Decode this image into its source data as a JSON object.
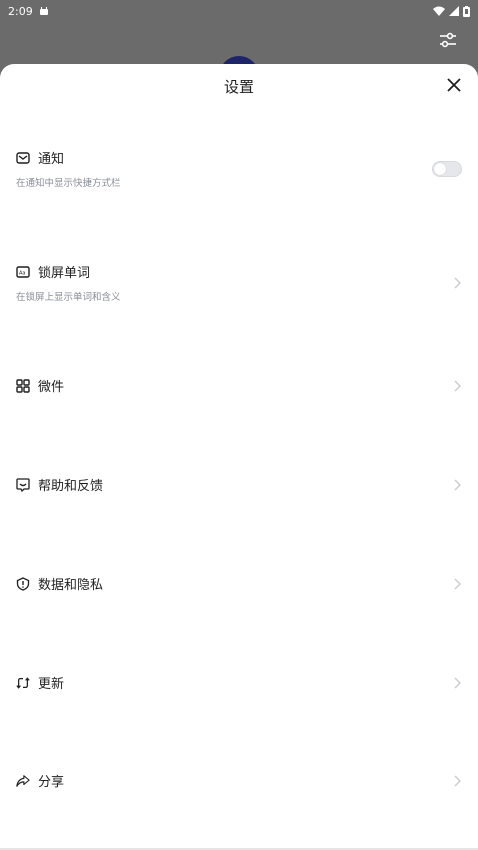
{
  "status_bar": {
    "time": "2:09"
  },
  "sheet": {
    "title": "设置"
  },
  "settings": {
    "notifications": {
      "label": "通知",
      "subtitle": "在通知中显示快捷方式栏",
      "toggle_on": false
    },
    "lockscreen": {
      "label": "锁屏单词",
      "subtitle": "在锁屏上显示单词和含义"
    },
    "widgets": {
      "label": "微件"
    },
    "help": {
      "label": "帮助和反馈"
    },
    "privacy": {
      "label": "数据和隐私"
    },
    "update": {
      "label": "更新"
    },
    "share": {
      "label": "分享"
    }
  },
  "icons": {
    "close": "close-icon",
    "filter": "sliders-icon",
    "notifications": "mail-icon",
    "lockscreen": "text-box-icon",
    "widgets": "grid-icon",
    "help": "chat-bubble-icon",
    "privacy": "shield-alert-icon",
    "update": "sync-icon",
    "share": "share-arrow-icon"
  },
  "colors": {
    "scrim": "#6b6b6b",
    "sheet": "#ffffff",
    "subtitle": "#8a8f98",
    "chevron": "#c8cbd0"
  }
}
